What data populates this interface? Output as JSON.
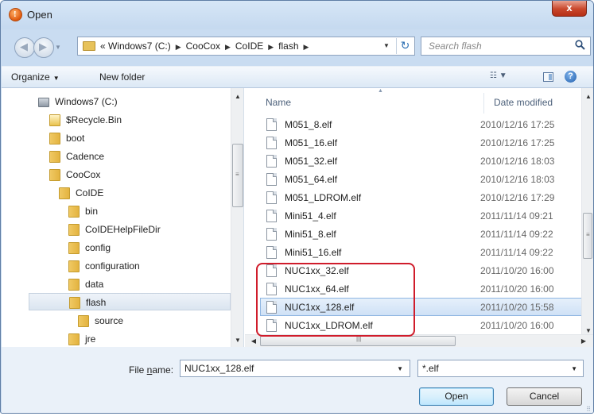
{
  "window": {
    "title": "Open",
    "close_label": "x"
  },
  "address": {
    "segments": [
      "« Windows7 (C:)",
      "CooCox",
      "CoIDE",
      "flash"
    ],
    "search_placeholder": "Search flash"
  },
  "toolbar": {
    "organize_label": "Organize",
    "new_folder_label": "New folder"
  },
  "tree": {
    "items": [
      {
        "label": "Windows7 (C:)",
        "type": "drive"
      },
      {
        "label": "$Recycle.Bin",
        "type": "recycle"
      },
      {
        "label": "boot",
        "type": "folder"
      },
      {
        "label": "Cadence",
        "type": "folder"
      },
      {
        "label": "CooCox",
        "type": "folder"
      },
      {
        "label": "CoIDE",
        "type": "folder"
      },
      {
        "label": "bin",
        "type": "folder"
      },
      {
        "label": "CoIDEHelpFileDir",
        "type": "folder"
      },
      {
        "label": "config",
        "type": "folder"
      },
      {
        "label": "configuration",
        "type": "folder"
      },
      {
        "label": "data",
        "type": "folder"
      },
      {
        "label": "flash",
        "type": "folder",
        "selected": true
      },
      {
        "label": "source",
        "type": "folder"
      },
      {
        "label": "jre",
        "type": "folder"
      }
    ]
  },
  "files": {
    "columns": {
      "name": "Name",
      "date": "Date modified"
    },
    "rows": [
      {
        "name": "M051_8.elf",
        "date": "2010/12/16 17:25"
      },
      {
        "name": "M051_16.elf",
        "date": "2010/12/16 17:25"
      },
      {
        "name": "M051_32.elf",
        "date": "2010/12/16 18:03"
      },
      {
        "name": "M051_64.elf",
        "date": "2010/12/16 18:03"
      },
      {
        "name": "M051_LDROM.elf",
        "date": "2010/12/16 17:29"
      },
      {
        "name": "Mini51_4.elf",
        "date": "2011/11/14 09:21"
      },
      {
        "name": "Mini51_8.elf",
        "date": "2011/11/14 09:22"
      },
      {
        "name": "Mini51_16.elf",
        "date": "2011/11/14 09:22"
      },
      {
        "name": "NUC1xx_32.elf",
        "date": "2011/10/20 16:00"
      },
      {
        "name": "NUC1xx_64.elf",
        "date": "2011/10/20 16:00"
      },
      {
        "name": "NUC1xx_128.elf",
        "date": "2011/10/20 15:58",
        "selected": true
      },
      {
        "name": "NUC1xx_LDROM.elf",
        "date": "2011/10/20 16:00"
      }
    ]
  },
  "bottom": {
    "file_name_label_prefix": "File ",
    "file_name_label_accel": "n",
    "file_name_label_suffix": "ame:",
    "file_name_value": "NUC1xx_128.elf",
    "filter_value": "*.elf",
    "open_label": "Open",
    "cancel_label": "Cancel"
  },
  "colors": {
    "accent_highlight": "#d01c2b",
    "selection": "#cfe1f6",
    "title_bar": "#c5d9ef"
  }
}
